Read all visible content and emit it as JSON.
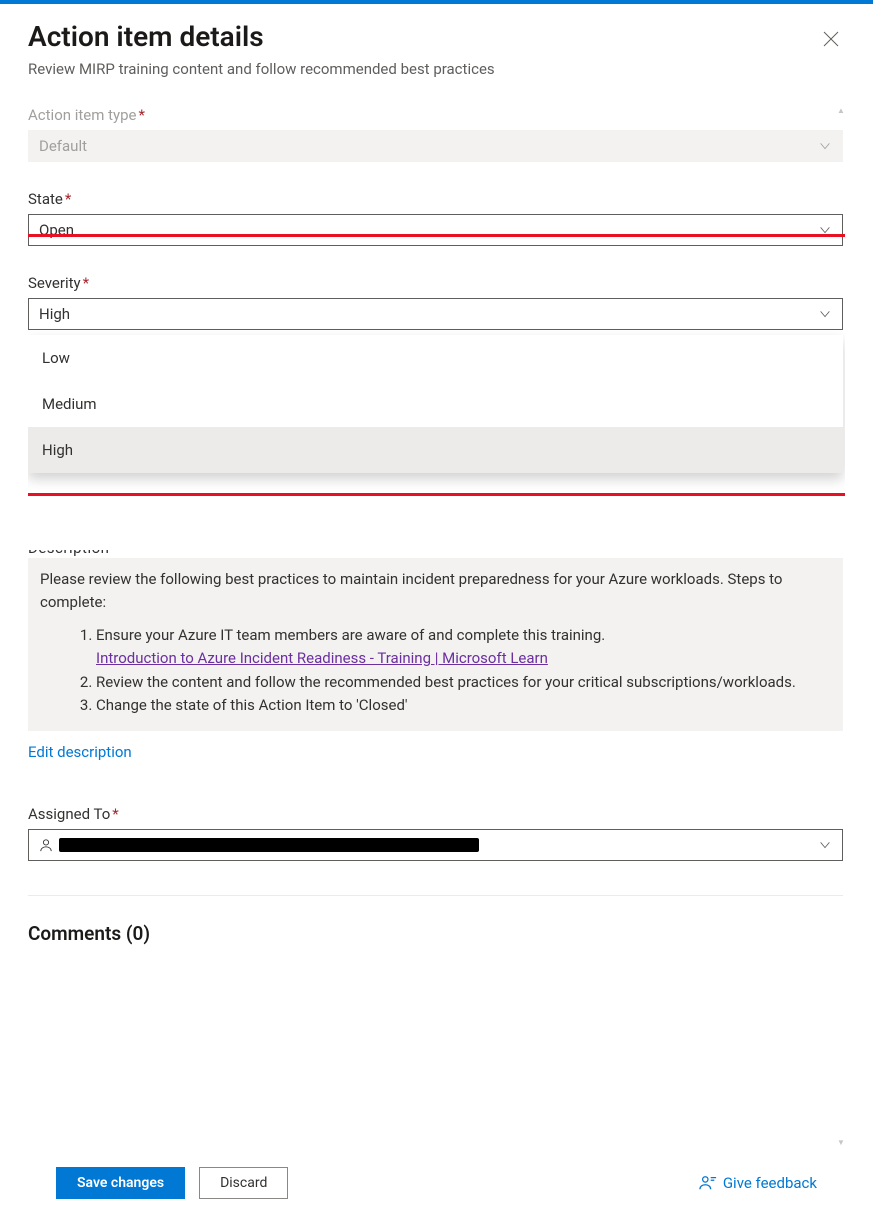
{
  "header": {
    "title": "Action item details",
    "subtitle": "Review MIRP training content and follow recommended best practices"
  },
  "fields": {
    "actionItemType": {
      "label": "Action item type",
      "value": "Default",
      "required": true
    },
    "state": {
      "label": "State",
      "value": "Open",
      "required": true
    },
    "severity": {
      "label": "Severity",
      "value": "High",
      "required": true,
      "options": [
        "Low",
        "Medium",
        "High"
      ]
    },
    "description": {
      "intro": "Please review the following best practices to maintain incident preparedness for your Azure workloads. Steps to complete:",
      "step1": "Ensure your Azure IT team members are aware of and complete this training.",
      "step1_link": "Introduction to Azure Incident Readiness - Training | Microsoft Learn",
      "step2": "Review the content and follow the recommended best practices for your critical subscriptions/workloads.",
      "step3": "Change the state of this Action Item to 'Closed'",
      "edit_label": "Edit description"
    },
    "assignedTo": {
      "label": "Assigned To",
      "required": true
    }
  },
  "comments": {
    "heading": "Comments (0)"
  },
  "footer": {
    "save": "Save changes",
    "discard": "Discard",
    "feedback": "Give feedback"
  }
}
